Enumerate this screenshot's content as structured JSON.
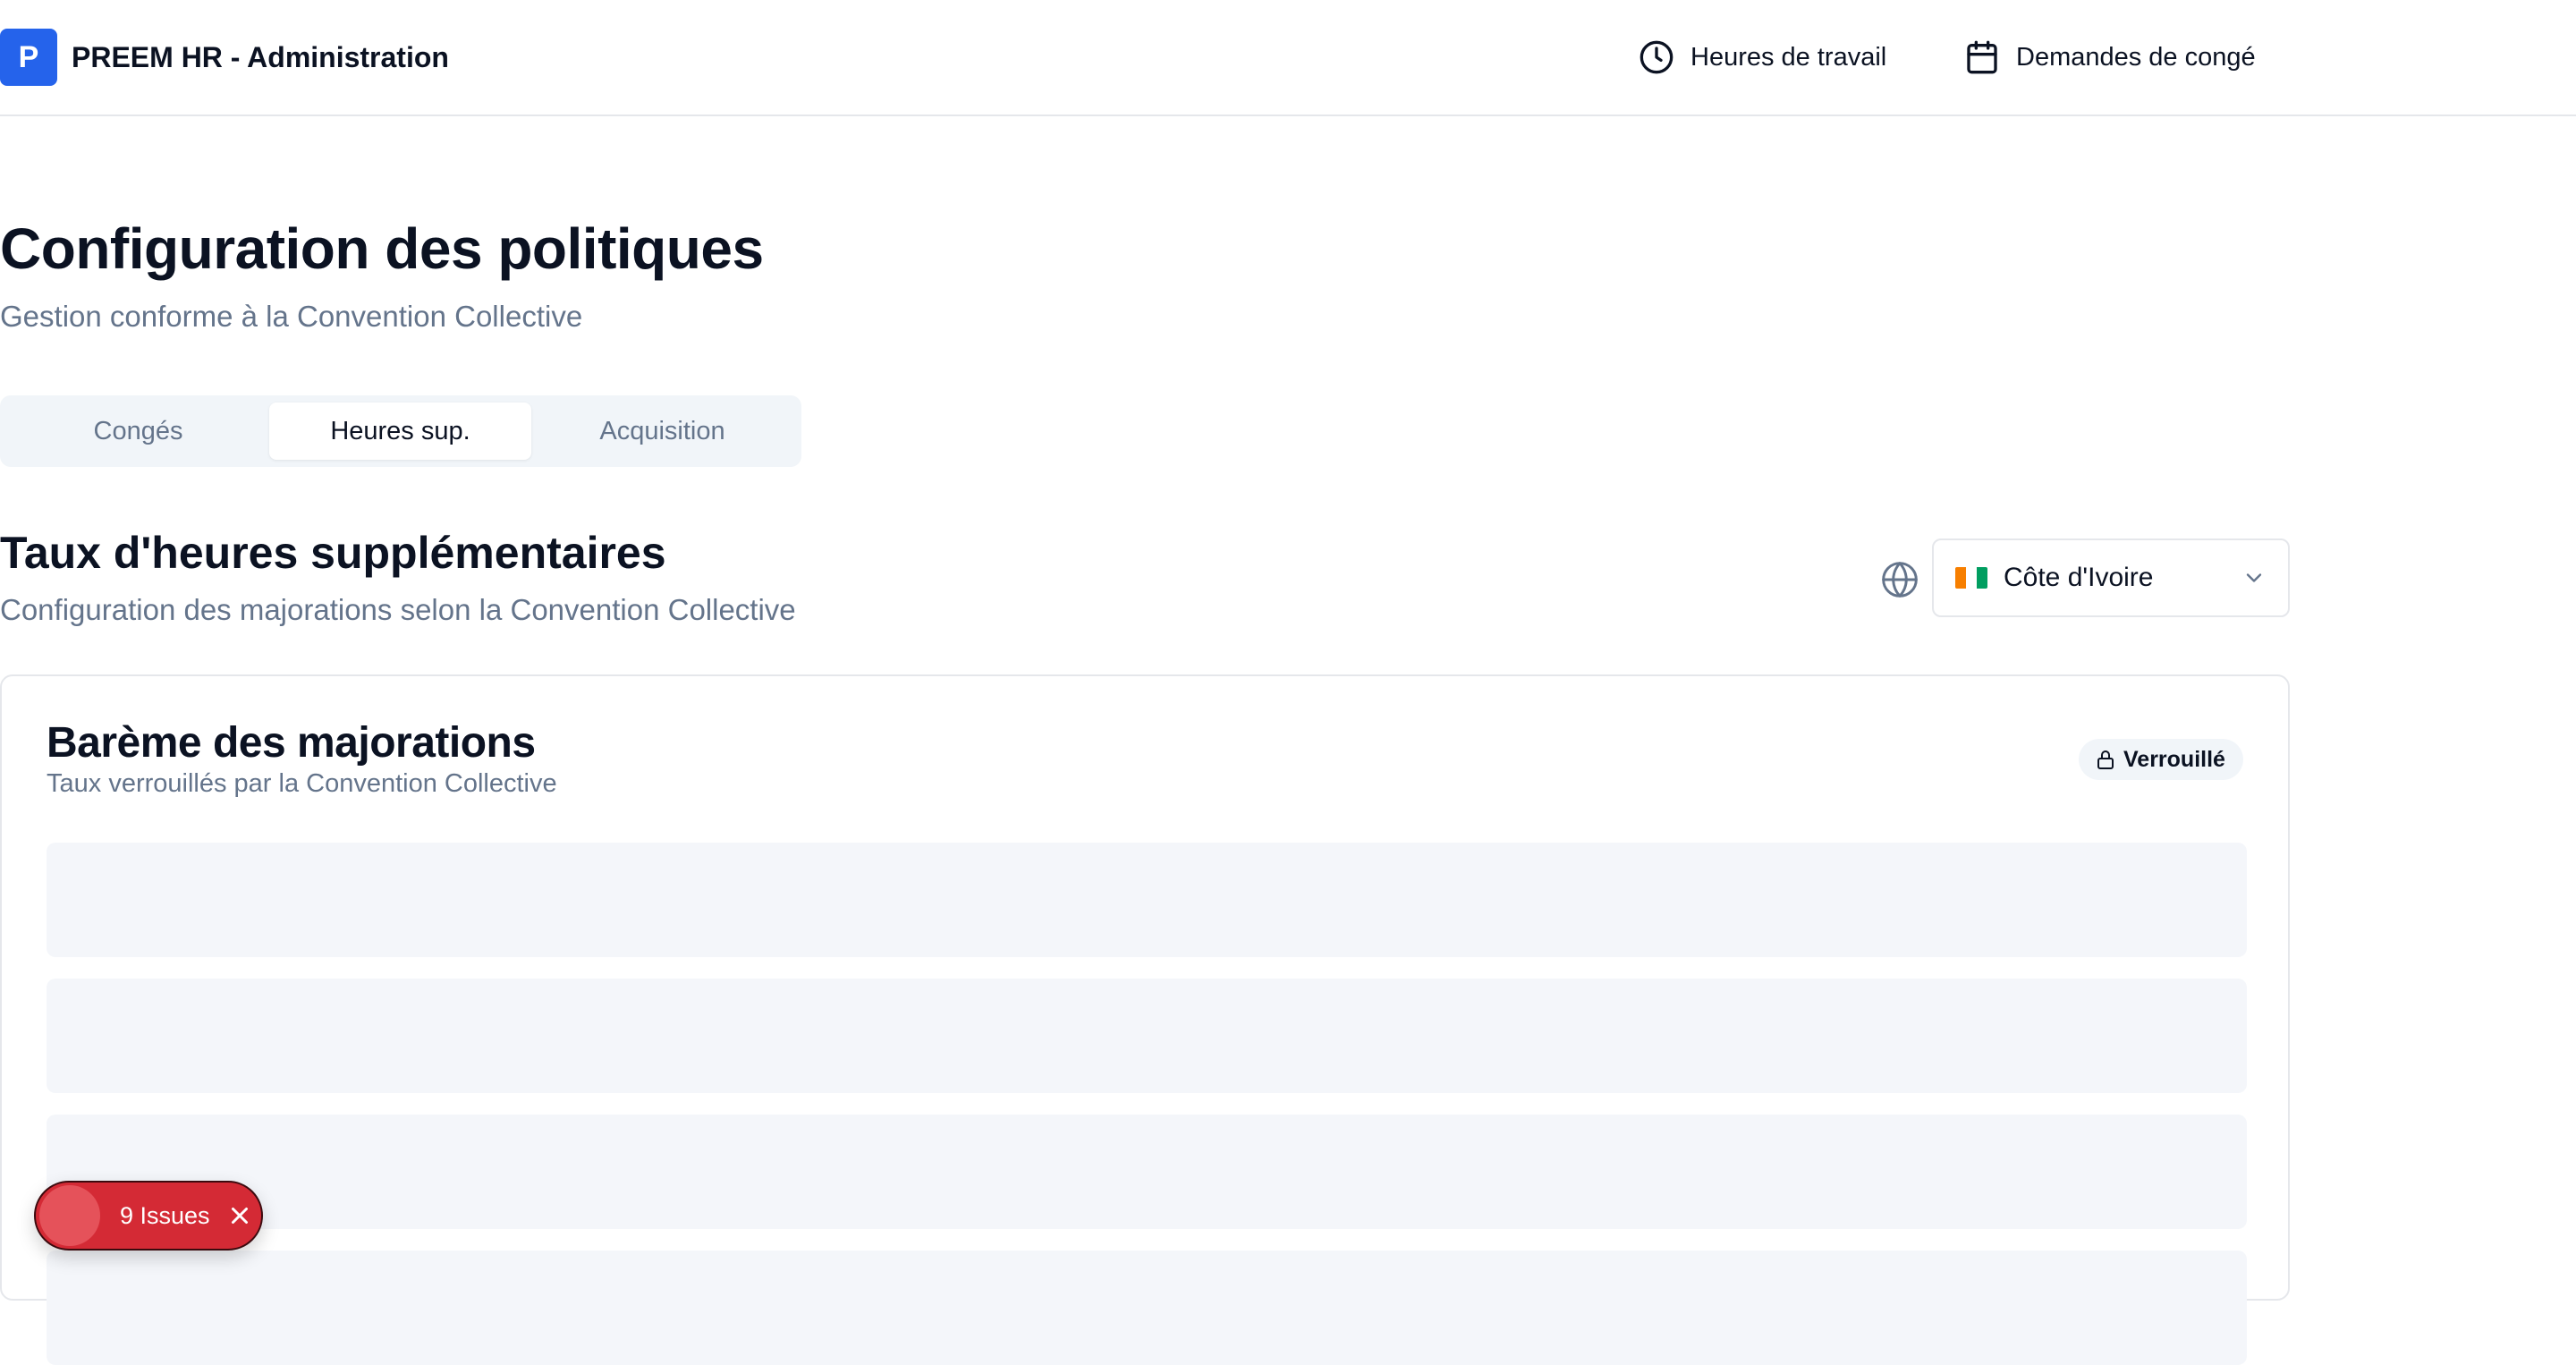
{
  "header": {
    "logo_letter": "P",
    "app_title": "PREEM HR - Administration",
    "nav": [
      {
        "label": "Heures de travail",
        "icon": "clock-icon"
      },
      {
        "label": "Demandes de congé",
        "icon": "calendar-icon"
      }
    ]
  },
  "page": {
    "title": "Configuration des politiques",
    "subtitle": "Gestion conforme à la Convention Collective"
  },
  "tabs": [
    {
      "label": "Congés",
      "active": false
    },
    {
      "label": "Heures sup.",
      "active": true
    },
    {
      "label": "Acquisition",
      "active": false
    }
  ],
  "section": {
    "title": "Taux d'heures supplémentaires",
    "subtitle": "Configuration des majorations selon la Convention Collective",
    "country_select": {
      "value": "Côte d'Ivoire",
      "flag_colors": [
        "#f77f00",
        "#ffffff",
        "#009e60"
      ]
    }
  },
  "card": {
    "title": "Barème des majorations",
    "subtitle": "Taux verrouillés par la Convention Collective",
    "badge": "Verrouillé"
  },
  "issues": {
    "label": "9 Issues",
    "color": "#d42a35"
  },
  "colors": {
    "accent": "#2563eb",
    "muted_text": "#64748b"
  }
}
